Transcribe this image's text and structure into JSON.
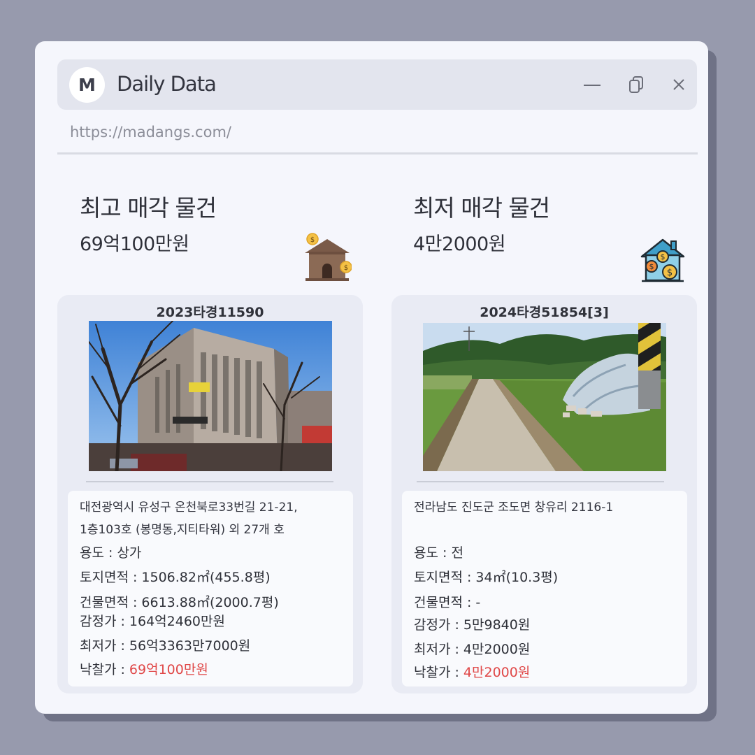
{
  "app": {
    "avatar_letter": "M",
    "title": "Daily Data",
    "url": "https://madangs.com/"
  },
  "icons": {
    "minimize": "minimize-icon",
    "restore": "restore-icon",
    "close": "close-icon",
    "left_decoration": "house-with-coins-icon",
    "right_decoration": "house-with-coins-icon"
  },
  "colors": {
    "background": "#979aad",
    "window": "#f5f6fc",
    "titlebar": "#e3e5ee",
    "card": "#e9ebf4",
    "highlight_price": "#e04848"
  },
  "highest": {
    "heading": "최고 매각 물건",
    "price": "69억100만원",
    "case_number": "2023타경11590",
    "address_line1": "대전광역시 유성구 온천북로33번길 21-21,",
    "address_line2": "1층103호 (봉명동,지티타워) 외 27개 호",
    "usage": "용도 : 상가",
    "land_area": "토지면적 : 1506.82㎡(455.8평)",
    "building_area": "건물면적 : 6613.88㎡(2000.7평)",
    "appraisal": "감정가 : 164억2460만원",
    "minimum": "최저가 : 56억3363만7000원",
    "winning_label": "낙찰가 : ",
    "winning_value": "69억100만원"
  },
  "lowest": {
    "heading": "최저 매각 물건",
    "price": "4만2000원",
    "case_number": "2024타경51854[3]",
    "address_line1": "전라남도 진도군 조도면 창유리 2116-1",
    "usage": "용도 : 전",
    "land_area": "토지면적 : 34㎡(10.3평)",
    "building_area": "건물면적 : -",
    "appraisal": "감정가 : 5만9840원",
    "minimum": "최저가 : 4만2000원",
    "winning_label": "낙찰가 : ",
    "winning_value": "4만2000원"
  }
}
